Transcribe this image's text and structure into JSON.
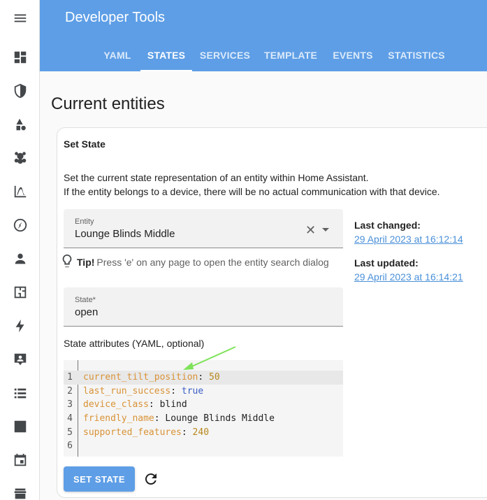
{
  "header": {
    "title": "Developer Tools",
    "tabs": [
      "YAML",
      "STATES",
      "SERVICES",
      "TEMPLATE",
      "EVENTS",
      "STATISTICS"
    ],
    "active_tab": "STATES"
  },
  "sidebar": {
    "icons": [
      "menu-icon",
      "dashboard-icon",
      "shield-icon",
      "shapes-icon",
      "teddy-bear-icon",
      "chart-icon",
      "compass-icon",
      "person-icon",
      "floorplan-icon",
      "lightning-icon",
      "badge-icon",
      "list-icon",
      "bar-chart-icon",
      "calendar-icon",
      "store-icon"
    ]
  },
  "page": {
    "title": "Current entities"
  },
  "set_state": {
    "title": "Set State",
    "description_line1": "Set the current state representation of an entity within Home Assistant.",
    "description_line2": "If the entity belongs to a device, there will be no actual communication with that device.",
    "entity_label": "Entity",
    "entity_value": "Lounge Blinds Middle",
    "tip_bold": "Tip!",
    "tip_text": "Press 'e' on any page to open the entity search dialog",
    "state_label": "State*",
    "state_value": "open",
    "attributes_label": "State attributes (YAML, optional)",
    "yaml_lines": [
      {
        "num": "1",
        "key": "current_tilt_position",
        "value": "50"
      },
      {
        "num": "2",
        "key": "last_run_success",
        "value": "true"
      },
      {
        "num": "3",
        "key": "device_class",
        "value": "blind"
      },
      {
        "num": "4",
        "key": "friendly_name",
        "value": "Lounge Blinds Middle"
      },
      {
        "num": "5",
        "key": "supported_features",
        "value": "240"
      },
      {
        "num": "6",
        "key": "",
        "value": ""
      }
    ],
    "set_button": "SET STATE",
    "last_changed_label": "Last changed:",
    "last_changed_value": "29 April 2023 at 16:12:14",
    "last_updated_label": "Last updated:",
    "last_updated_value": "29 April 2023 at 16:14:21"
  },
  "colors": {
    "header_bg": "#5e9ee6",
    "link": "#4a90d9",
    "yaml_key": "#d99236",
    "annotation_arrow": "#7ee35a"
  }
}
